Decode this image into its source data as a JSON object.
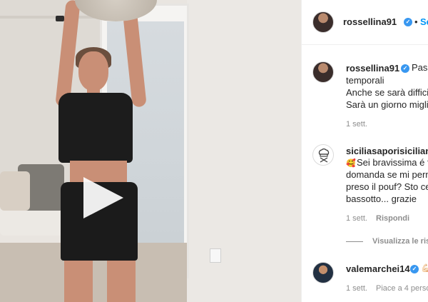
{
  "video": {
    "play_button_label": "Play"
  },
  "post_header": {
    "username": "rossellina91",
    "separator": "•",
    "follow_label": "Segui"
  },
  "caption": {
    "username": "rossellina91",
    "lines": [
      "Pass",
      "temporali",
      "Anche se sarà difficil",
      "Sarà un giorno miglio"
    ],
    "timestamp": "1 sett."
  },
  "comments": [
    {
      "username": "siciliasaporisiciliani",
      "lines": [
        "Sei bravissima é fo",
        "domanda se mi perm",
        "preso il pouf? Sto cer",
        "bassotto... grazie"
      ],
      "leading_emoji": "🥰",
      "timestamp": "1 sett.",
      "reply_label": "Rispondi",
      "view_replies_label": "Visualizza le ris"
    },
    {
      "username": "valemarchei14",
      "trailing_emoji": "💪🏻",
      "timestamp": "1 sett.",
      "likes_label": "Piace a 4 perso"
    }
  ],
  "icons": {
    "verified": "verified-badge-icon",
    "play": "play-icon"
  },
  "colors": {
    "link_blue": "#0095f6",
    "verified_blue": "#3897f0",
    "meta_gray": "#8e8e8e"
  }
}
